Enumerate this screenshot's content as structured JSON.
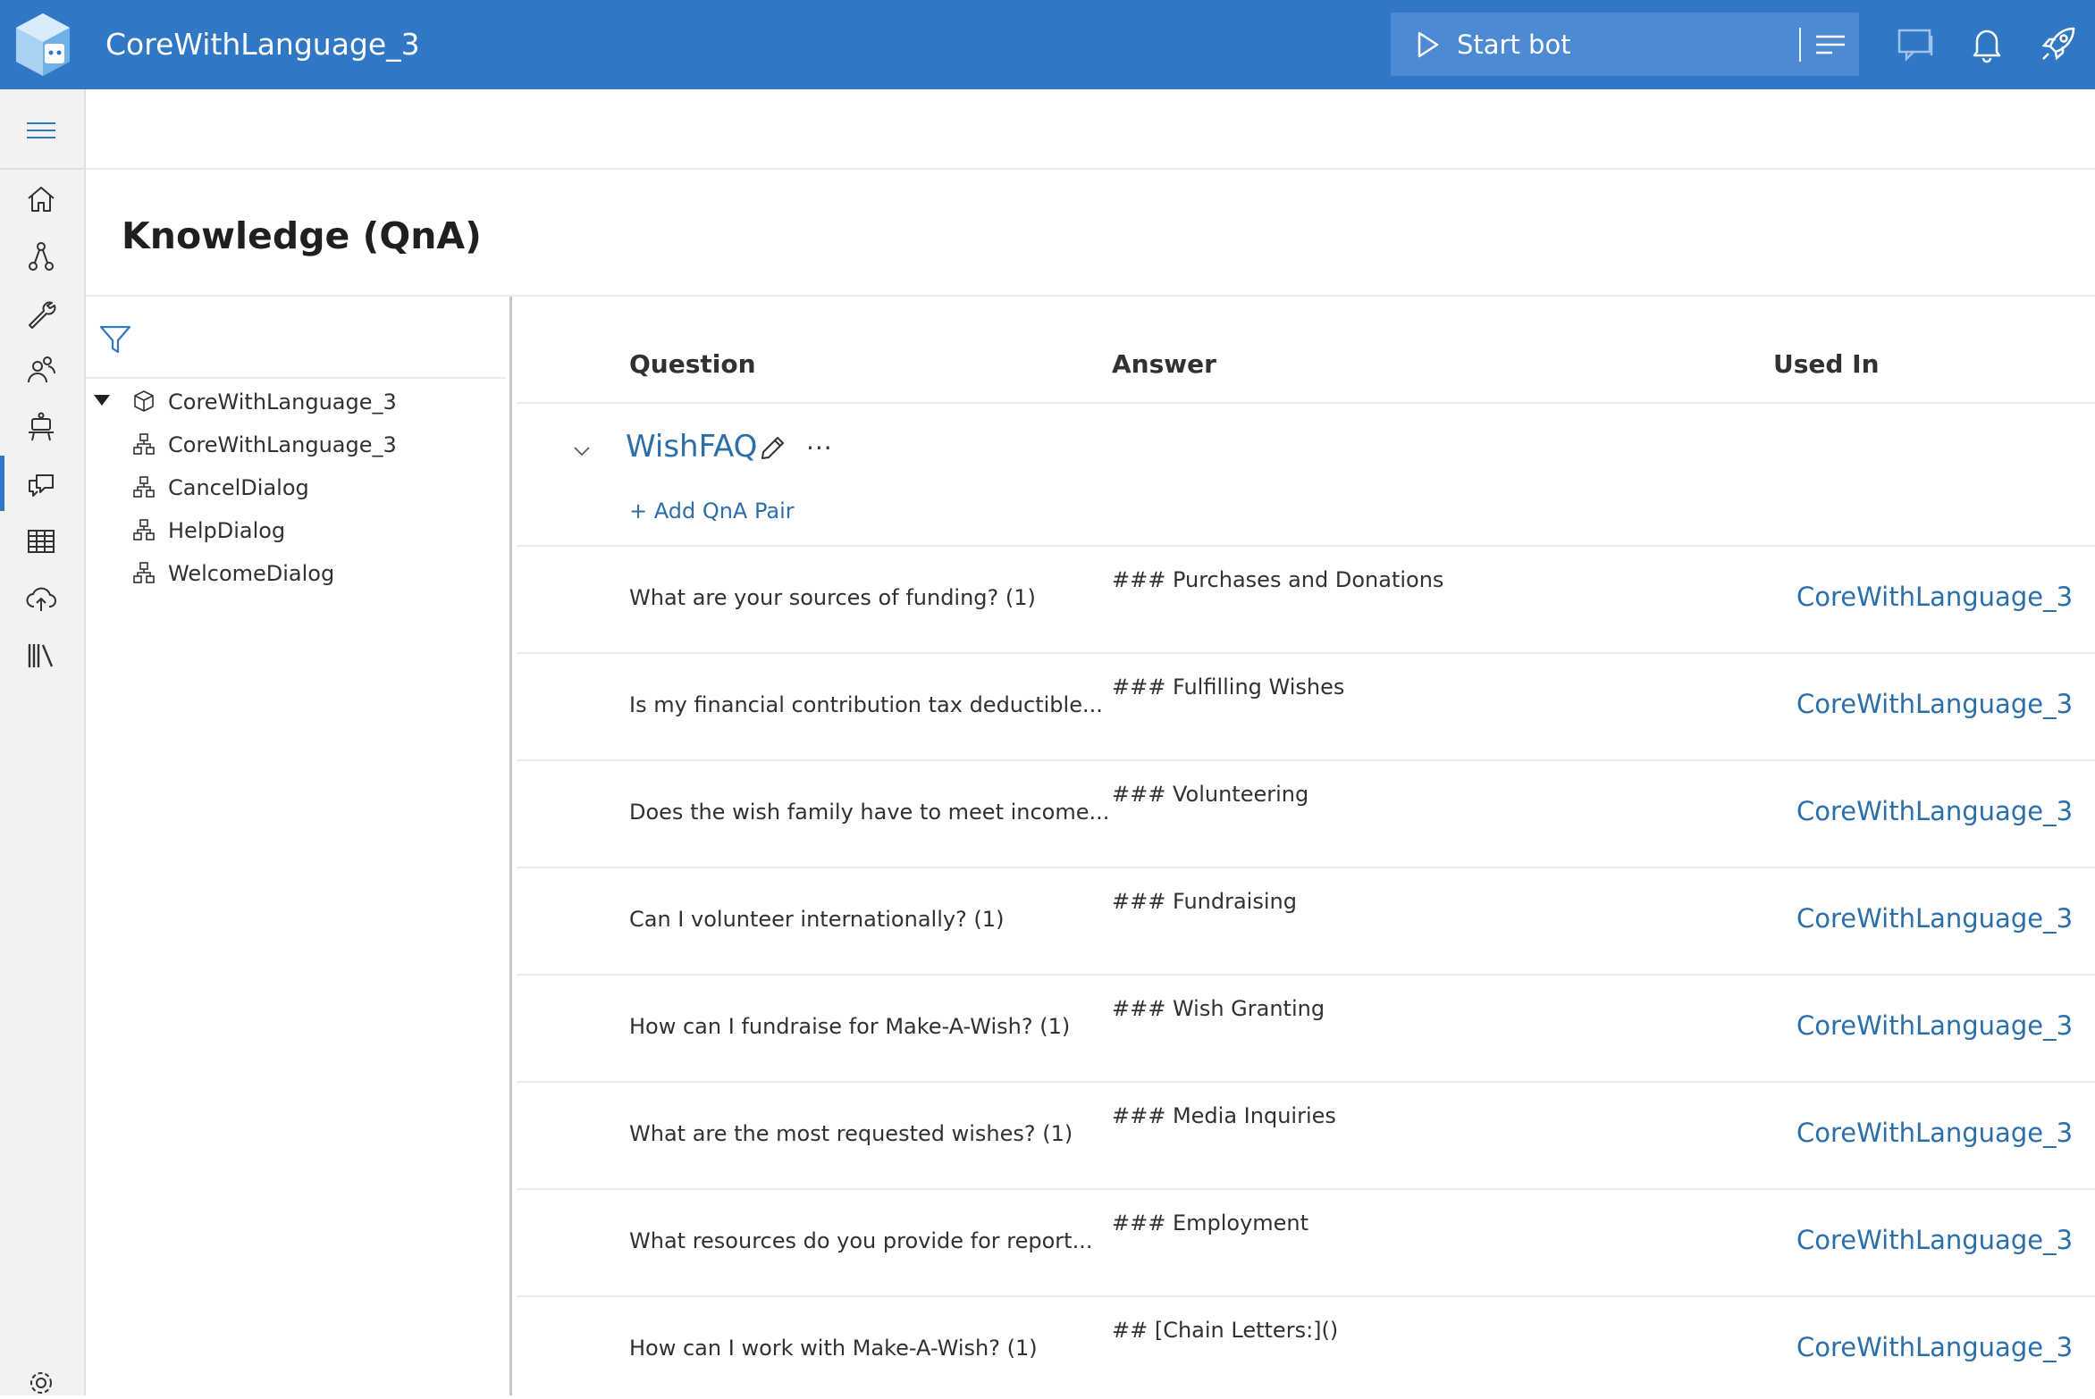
{
  "header": {
    "app_title": "CoreWithLanguage_3",
    "start_bot_label": "Start bot",
    "icons": [
      "bot-logo-icon",
      "play-icon",
      "menu-lines-icon",
      "chat-icon",
      "bell-icon",
      "rocket-icon"
    ]
  },
  "sidebar": {
    "items": [
      {
        "name": "home-icon"
      },
      {
        "name": "design-icon"
      },
      {
        "name": "configure-icon"
      },
      {
        "name": "users-icon"
      },
      {
        "name": "bot-responses-icon"
      },
      {
        "name": "knowledge-qna-icon",
        "active": true
      },
      {
        "name": "table-icon"
      },
      {
        "name": "publish-icon"
      },
      {
        "name": "library-icon"
      }
    ],
    "settings_icon": "gear-icon"
  },
  "page": {
    "title": "Knowledge (QnA)"
  },
  "tree": {
    "root": {
      "label": "CoreWithLanguage_3",
      "icon": "cube-icon",
      "expanded": true
    },
    "children": [
      {
        "label": "CoreWithLanguage_3",
        "icon": "dialog-icon"
      },
      {
        "label": "CancelDialog",
        "icon": "dialog-icon"
      },
      {
        "label": "HelpDialog",
        "icon": "dialog-icon"
      },
      {
        "label": "WelcomeDialog",
        "icon": "dialog-icon"
      }
    ]
  },
  "grid": {
    "columns": {
      "question": "Question",
      "answer": "Answer",
      "used_in": "Used In"
    },
    "group": {
      "name": "WishFAQ",
      "more": "···",
      "add_pair": "+ Add QnA Pair"
    },
    "rows": [
      {
        "question": "What are your sources of funding?  (1)",
        "answer": "### Purchases and Donations",
        "used_in": "CoreWithLanguage_3"
      },
      {
        "question": "Is my financial contribution tax deductible...",
        "answer": "### Fulfilling Wishes",
        "used_in": "CoreWithLanguage_3"
      },
      {
        "question": "Does the wish family have to meet income...",
        "answer": "### Volunteering",
        "used_in": "CoreWithLanguage_3"
      },
      {
        "question": "Can I volunteer internationally?  (1)",
        "answer": "### Fundraising",
        "used_in": "CoreWithLanguage_3"
      },
      {
        "question": "How can I fundraise for Make-A-Wish?  (1)",
        "answer": "### Wish Granting",
        "used_in": "CoreWithLanguage_3"
      },
      {
        "question": "What are the most requested wishes?  (1)",
        "answer": "### Media Inquiries",
        "used_in": "CoreWithLanguage_3"
      },
      {
        "question": "What resources do you provide for report...",
        "answer": "### Employment",
        "used_in": "CoreWithLanguage_3"
      },
      {
        "question": "How can I work with Make-A-Wish?  (1)",
        "answer": "## [Chain Letters:]()",
        "used_in": "CoreWithLanguage_3"
      }
    ]
  },
  "colors": {
    "header_bg": "#3078c6",
    "start_bot_bg": "#4c8ad3",
    "link": "#2b6ea9",
    "sidebar_bg": "#f3f2f1"
  }
}
